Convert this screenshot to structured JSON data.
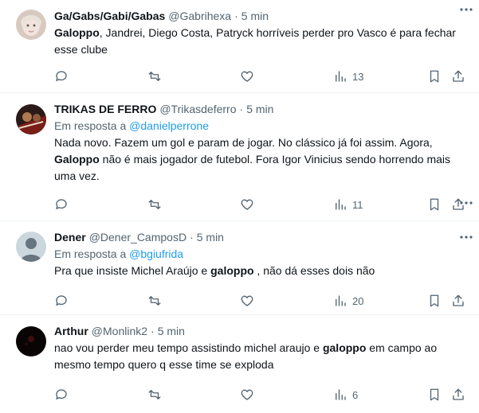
{
  "tweets": [
    {
      "name": "Ga/Gabs/Gabi/Gabas",
      "handle": "@Gabrihexa",
      "dot": "·",
      "time": "5 min",
      "reply_prefix": "",
      "reply_to": "",
      "text_bold_1": "Galoppo",
      "text_after_1": ", Jandrei, Diego Costa, Patryck horríveis perder pro Vasco é para fechar esse clube",
      "views": "13",
      "avatar_icon": "profile-photo"
    },
    {
      "name": "TRIKAS DE FERRO",
      "handle": "@Trikasdeferro",
      "dot": "·",
      "time": "5 min",
      "reply_prefix": "Em resposta a",
      "reply_to": "@danielperrone",
      "text_before_1": "Nada novo. Fazem um gol e param de jogar. No clássico já foi assim. Agora, ",
      "text_bold_1": "Galoppo",
      "text_after_1": " não é mais jogador de futebol. Fora Igor Vinicius sendo horrendo mais uma vez.",
      "views": "11",
      "avatar_icon": "profile-photo"
    },
    {
      "name": "Dener",
      "handle": "@Dener_CamposD",
      "dot": "·",
      "time": "5 min",
      "reply_prefix": "Em resposta a",
      "reply_to": "@bgiufrida",
      "text_before_1": "Pra que insiste Michel Araújo e ",
      "text_bold_1": "galoppo",
      "text_after_1": " , não dá esses dois não",
      "views": "20",
      "avatar_icon": "default-profile-icon"
    },
    {
      "name": "Arthur",
      "handle": "@Monlink2",
      "dot": "·",
      "time": "5 min",
      "reply_prefix": "",
      "reply_to": "",
      "text_before_1": "nao vou perder meu tempo assistindo michel araujo e ",
      "text_bold_1": "galoppo",
      "text_after_1": " em campo ao mesmo tempo quero q esse time se exploda",
      "views": "6",
      "avatar_icon": "profile-photo"
    }
  ],
  "colors": {
    "text": "#0f1419",
    "muted": "#536471",
    "link": "#1d9bf0",
    "divider": "#eff3f4"
  }
}
